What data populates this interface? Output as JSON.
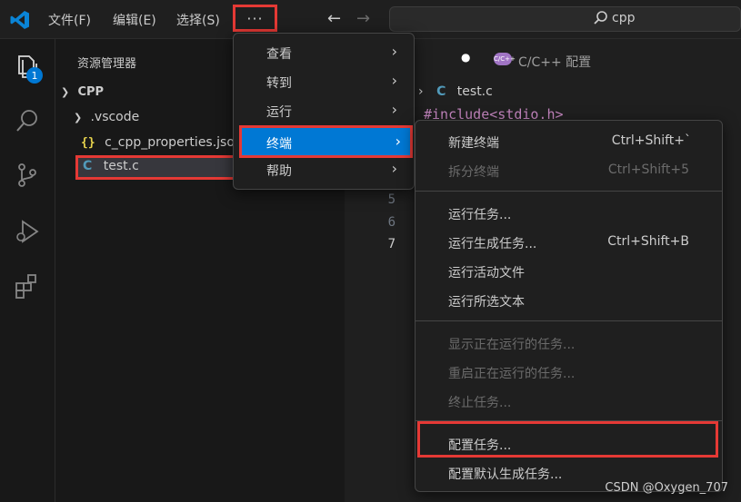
{
  "menubar": {
    "file": "文件(F)",
    "edit": "编辑(E)",
    "selection": "选择(S)",
    "more": "···"
  },
  "search": {
    "text": "cpp"
  },
  "activity": {
    "badge": "1"
  },
  "sidebar": {
    "title": "资源管理器",
    "folder": "CPP",
    "subfolder": ".vscode",
    "json_file": "c_cpp_properties.json",
    "c_file": "test.c",
    "json_icon": "{}",
    "c_icon": "C"
  },
  "editor": {
    "tab_label": "C/C++ 配置",
    "breadcrumb_file": "test.c",
    "breadcrumb_icon": "C",
    "code_line": "#include<stdio.h>",
    "line_numbers": [
      "5",
      "6",
      "7"
    ]
  },
  "menu_more": {
    "items": [
      {
        "label": "查看"
      },
      {
        "label": "转到"
      },
      {
        "label": "运行"
      },
      {
        "label": "终端"
      },
      {
        "label": "帮助"
      }
    ]
  },
  "menu_terminal": {
    "items": [
      {
        "label": "新建终端",
        "kbd": "Ctrl+Shift+`"
      },
      {
        "label": "拆分终端",
        "kbd": "Ctrl+Shift+5"
      },
      {
        "label": "运行任务..."
      },
      {
        "label": "运行生成任务...",
        "kbd": "Ctrl+Shift+B"
      },
      {
        "label": "运行活动文件"
      },
      {
        "label": "运行所选文本"
      },
      {
        "label": "显示正在运行的任务..."
      },
      {
        "label": "重启正在运行的任务..."
      },
      {
        "label": "终止任务..."
      },
      {
        "label": "配置任务..."
      },
      {
        "label": "配置默认生成任务..."
      }
    ]
  },
  "watermark": "CSDN @Oxygen_707",
  "colors": {
    "accent": "#0078d4",
    "annotation": "#e53935",
    "json_icon": "#e8d44d",
    "c_icon": "#519aba"
  }
}
